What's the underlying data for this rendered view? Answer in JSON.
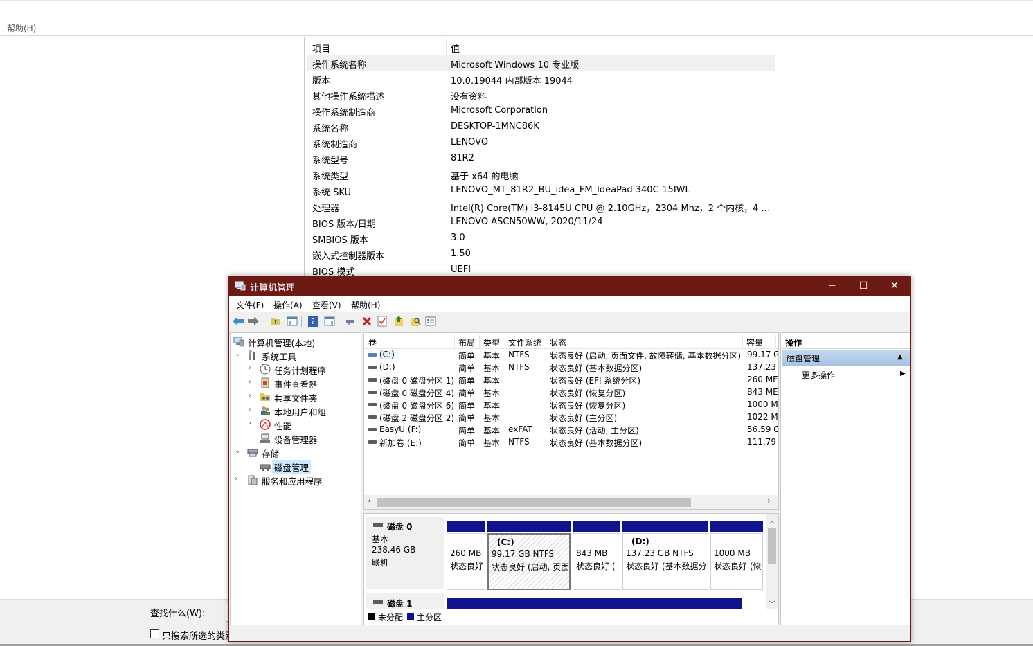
{
  "background": {
    "menu": "帮助(H)",
    "list_header": {
      "item": "项目",
      "value": "值"
    },
    "rows": [
      {
        "k": "操作系统名称",
        "v": "Microsoft Windows 10 专业版"
      },
      {
        "k": "版本",
        "v": "10.0.19044 内部版本 19044"
      },
      {
        "k": "其他操作系统描述",
        "v": "没有资料"
      },
      {
        "k": "操作系统制造商",
        "v": "Microsoft Corporation"
      },
      {
        "k": "系统名称",
        "v": "DESKTOP-1MNC86K"
      },
      {
        "k": "系统制造商",
        "v": "LENOVO"
      },
      {
        "k": "系统型号",
        "v": "81R2"
      },
      {
        "k": "系统类型",
        "v": "基于 x64 的电脑"
      },
      {
        "k": "系统 SKU",
        "v": "LENOVO_MT_81R2_BU_idea_FM_IdeaPad 340C-15IWL"
      },
      {
        "k": "处理器",
        "v": "Intel(R) Core(TM) i3-8145U CPU @ 2.10GHz，2304 Mhz，2 个内核，4 个..."
      },
      {
        "k": "BIOS 版本/日期",
        "v": "LENOVO ASCN50WW, 2020/11/24"
      },
      {
        "k": "SMBIOS 版本",
        "v": "3.0"
      },
      {
        "k": "嵌入式控制器版本",
        "v": "1.50"
      },
      {
        "k": "BIOS 模式",
        "v": "UEFI"
      }
    ],
    "find_label": "查找什么(W):",
    "search_selected_label": "只搜索所选的类别"
  },
  "window": {
    "title": "计算机管理",
    "controls": {
      "minimize": "─",
      "maximize": "☐",
      "close": "✕"
    },
    "menu": [
      "文件(F)",
      "操作(A)",
      "查看(V)",
      "帮助(H)"
    ]
  },
  "tree": {
    "root": "计算机管理(本地)",
    "system_tools": "系统工具",
    "task_scheduler": "任务计划程序",
    "event_viewer": "事件查看器",
    "shared_folders": "共享文件夹",
    "local_users": "本地用户和组",
    "performance": "性能",
    "device_manager": "设备管理器",
    "storage": "存储",
    "disk_management": "磁盘管理",
    "services_apps": "服务和应用程序"
  },
  "volumes": {
    "headers": {
      "vol": "卷",
      "layout": "布局",
      "type": "类型",
      "fs": "文件系统",
      "status": "状态",
      "capacity": "容量"
    },
    "rows": [
      {
        "vol": "(C:)",
        "layout": "简单",
        "type": "基本",
        "fs": "NTFS",
        "status": "状态良好 (启动, 页面文件, 故障转储, 基本数据分区)",
        "cap": "99.17 G"
      },
      {
        "vol": "(D:)",
        "layout": "简单",
        "type": "基本",
        "fs": "NTFS",
        "status": "状态良好 (基本数据分区)",
        "cap": "137.23"
      },
      {
        "vol": "(磁盘 0 磁盘分区 1)",
        "layout": "简单",
        "type": "基本",
        "fs": "",
        "status": "状态良好 (EFI 系统分区)",
        "cap": "260 ME"
      },
      {
        "vol": "(磁盘 0 磁盘分区 4)",
        "layout": "简单",
        "type": "基本",
        "fs": "",
        "status": "状态良好 (恢复分区)",
        "cap": "843 ME"
      },
      {
        "vol": "(磁盘 0 磁盘分区 6)",
        "layout": "简单",
        "type": "基本",
        "fs": "",
        "status": "状态良好 (恢复分区)",
        "cap": "1000 M"
      },
      {
        "vol": "(磁盘 2 磁盘分区 2)",
        "layout": "简单",
        "type": "基本",
        "fs": "",
        "status": "状态良好 (主分区)",
        "cap": "1022 M"
      },
      {
        "vol": "EasyU (F:)",
        "layout": "简单",
        "type": "基本",
        "fs": "exFAT",
        "status": "状态良好 (活动, 主分区)",
        "cap": "56.59 G"
      },
      {
        "vol": "新加卷 (E:)",
        "layout": "简单",
        "type": "基本",
        "fs": "NTFS",
        "status": "状态良好 (基本数据分区)",
        "cap": "111.79"
      }
    ],
    "scroll_left": "‹",
    "scroll_right": "›"
  },
  "disk0": {
    "name": "磁盘 0",
    "type": "基本",
    "size": "238.46 GB",
    "state": "联机",
    "partitions": [
      {
        "label": "",
        "size": "260 MB",
        "status": "状态良好"
      },
      {
        "label": "(C:)",
        "size": "99.17 GB NTFS",
        "status": "状态良好 (启动, 页面"
      },
      {
        "label": "",
        "size": "843 MB",
        "status": "状态良好 ("
      },
      {
        "label": "(D:)",
        "size": "137.23 GB NTFS",
        "status": "状态良好 (基本数据分"
      },
      {
        "label": "",
        "size": "1000 MB",
        "status": "状态良好 (恢"
      }
    ]
  },
  "disk1": {
    "name": "磁盘 1"
  },
  "legend": {
    "unallocated": "未分配",
    "primary": "主分区"
  },
  "actions": {
    "header": "操作",
    "section": "磁盘管理",
    "more": "更多操作",
    "collapse_arrow": "▲",
    "more_arrow": "▶"
  },
  "colors": {
    "titlebar": "#6b1a14",
    "partition_bar": "#0f148c",
    "selection": "#cde8ff"
  }
}
